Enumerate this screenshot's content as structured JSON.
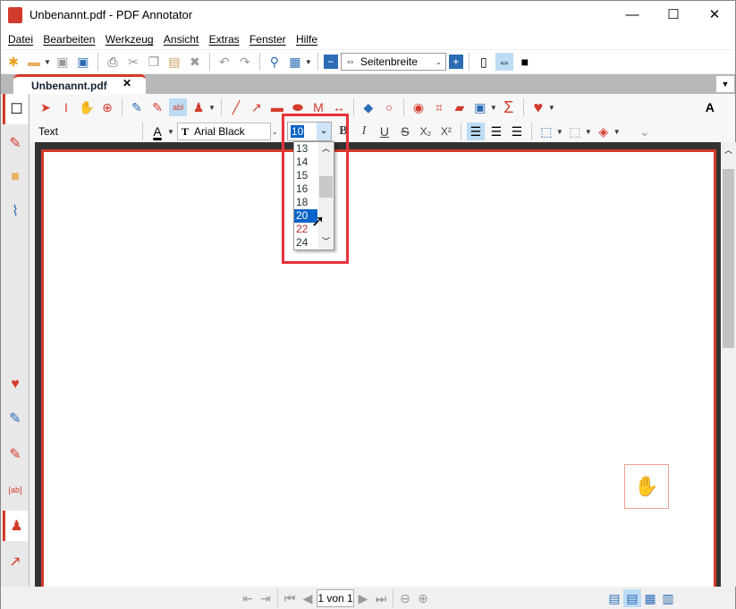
{
  "window": {
    "title": "Unbenannt.pdf - PDF Annotator",
    "minimize": "—",
    "maximize": "☐",
    "close": "✕"
  },
  "menu": [
    "Datei",
    "Bearbeiten",
    "Werkzeug",
    "Ansicht",
    "Extras",
    "Fenster",
    "Hilfe"
  ],
  "toolbar": {
    "zoom_value": "Seitenbreite"
  },
  "tab": {
    "label": "Unbenannt.pdf",
    "close": "✕"
  },
  "props": {
    "mode_label": "Text",
    "font": "Arial Black",
    "size": "10",
    "bold": "B",
    "italic": "I",
    "underline": "U",
    "strike": "S",
    "sub": "X₂",
    "sup": "X²"
  },
  "size_dropdown": {
    "options": [
      "13",
      "14",
      "15",
      "16",
      "18",
      "20",
      "22",
      "24"
    ],
    "selected": "20"
  },
  "status": {
    "page_indicator": "1 von 1"
  },
  "colors": {
    "accent": "#d33b2c",
    "selection": "#0a64c8",
    "highlight": "#e8323c"
  }
}
